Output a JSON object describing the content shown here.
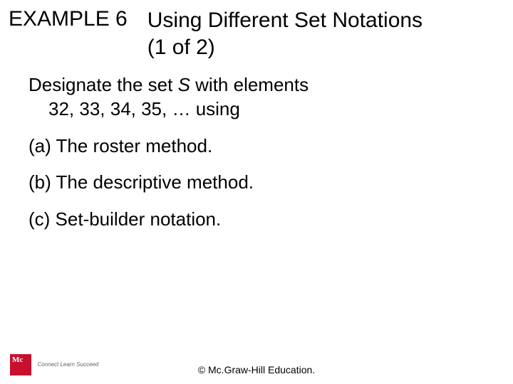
{
  "header": {
    "example_label": "EXAMPLE 6",
    "title_line1": "Using Different Set Notations",
    "title_line2": "(1 of 2)"
  },
  "body": {
    "prompt_pre": "Designate the set ",
    "set_name": "S",
    "prompt_post": " with elements",
    "prompt_line2": "32, 33, 34, 35, … using",
    "options": [
      "(a) The roster method.",
      "(b) The descriptive method.",
      "(c) Set-builder notation."
    ]
  },
  "footer": {
    "publisher_mark": "Mc",
    "tagline": "Connect Learn Succeed",
    "copyright": "© Mc.Graw-Hill Education."
  }
}
